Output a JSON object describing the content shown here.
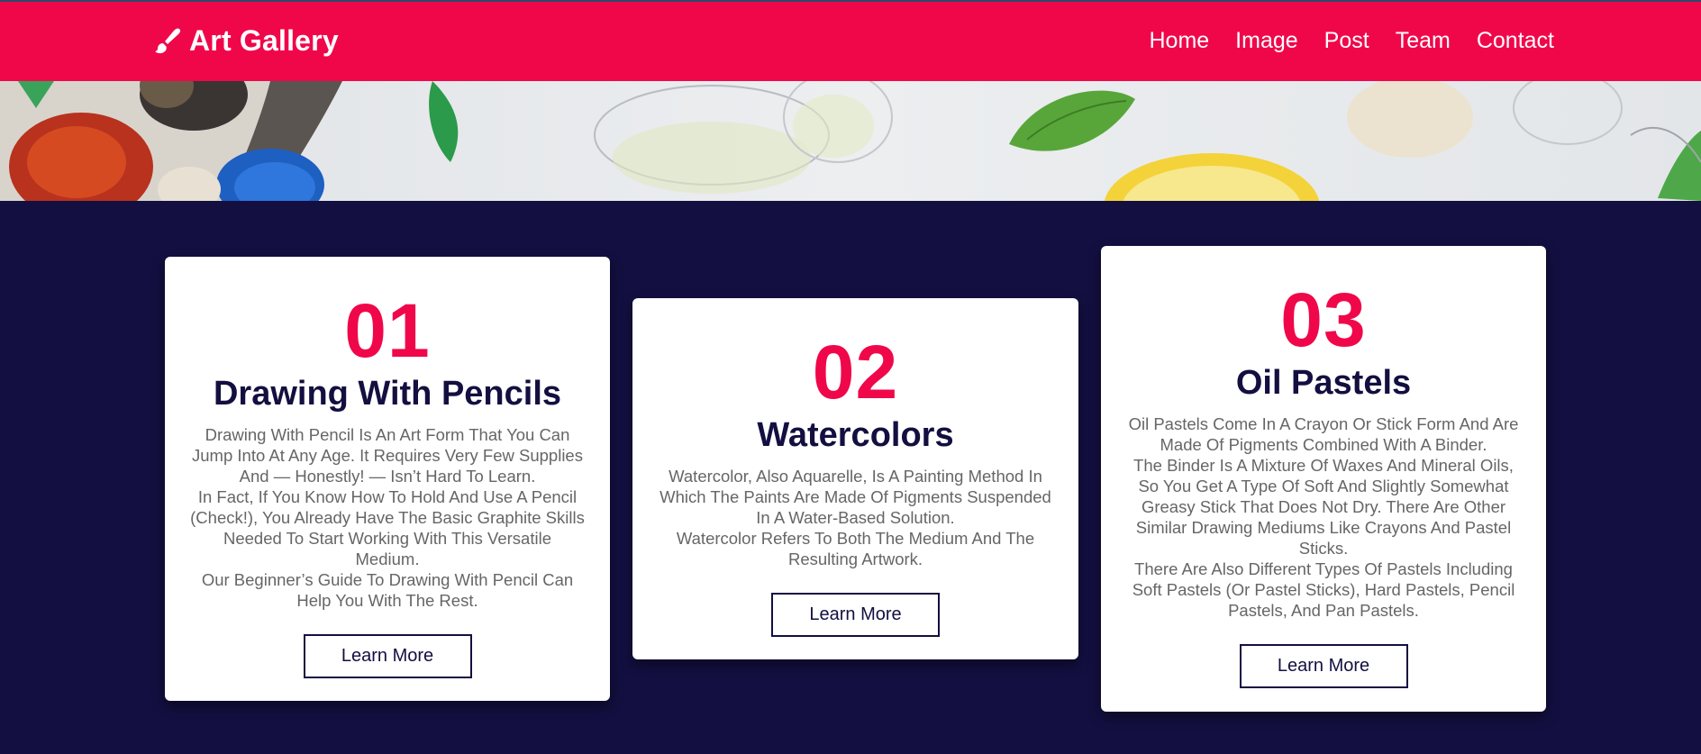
{
  "header": {
    "logo_text": "Art Gallery",
    "logo_icon": "paint-brush-icon",
    "nav": [
      "Home",
      "Image",
      "Post",
      "Team",
      "Contact"
    ]
  },
  "colors": {
    "accent": "#f0074a",
    "dark": "#130f40",
    "text_muted": "#666666",
    "card_bg": "#ffffff"
  },
  "cards": [
    {
      "number": "01",
      "title": "Drawing With Pencils",
      "paragraphs": [
        "Drawing With Pencil Is An Art Form That You Can Jump Into At Any Age. It Requires Very Few Supplies And — Honestly! — Isn’t Hard To Learn.",
        "In Fact, If You Know How To Hold And Use A Pencil (Check!), You Already Have The Basic Graphite Skills Needed To Start Working With This Versatile Medium.",
        "Our Beginner’s Guide To Drawing With Pencil Can Help You With The Rest."
      ],
      "button": "Learn More"
    },
    {
      "number": "02",
      "title": "Watercolors",
      "paragraphs": [
        "Watercolor, Also Aquarelle, Is A Painting Method In Which The Paints Are Made Of Pigments Suspended In A Water-Based Solution.",
        "Watercolor Refers To Both The Medium And The Resulting Artwork."
      ],
      "button": "Learn More"
    },
    {
      "number": "03",
      "title": "Oil Pastels",
      "paragraphs": [
        "Oil Pastels Come In A Crayon Or Stick Form And Are Made Of Pigments Combined With A Binder.",
        "The Binder Is A Mixture Of Waxes And Mineral Oils, So You Get A Type Of Soft And Slightly Somewhat Greasy Stick That Does Not Dry. There Are Other Similar Drawing Mediums Like Crayons And Pastel Sticks.",
        "There Are Also Different Types Of Pastels Including Soft Pastels (Or Pastel Sticks), Hard Pastels, Pencil Pastels, And Pan Pastels."
      ],
      "button": "Learn More"
    }
  ]
}
